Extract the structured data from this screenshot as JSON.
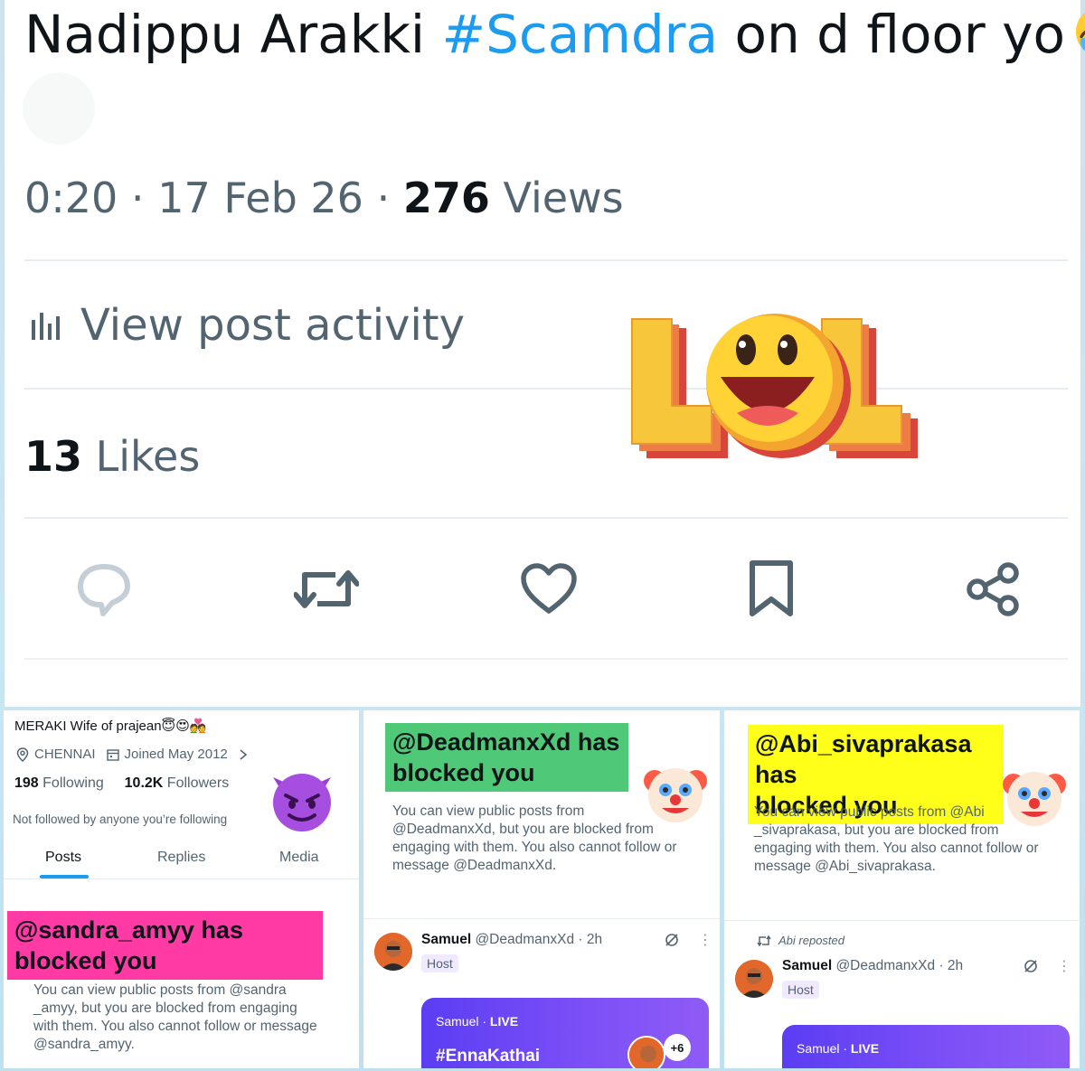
{
  "top_post": {
    "text_before": "Nadippu Arakki ",
    "hashtag": "#Scamdra",
    "text_after": " on d floor yo",
    "emoji": "rolling-on-floor-laughing-emoji",
    "meta_time": "0:20",
    "meta_sep": " · ",
    "meta_date": "17 Feb 26",
    "views_count": "276",
    "views_label": " Views",
    "activity_label": "View post activity",
    "likes_count": "13",
    "likes_label": " Likes",
    "sticker": "LOL",
    "actions": [
      "reply-icon",
      "repost-icon",
      "like-icon",
      "bookmark-icon",
      "share-icon"
    ],
    "colors": {
      "hashtag": "#1d9bf0",
      "muted": "#536471",
      "text": "#0f1419"
    }
  },
  "panel_sandra": {
    "bio": "MERAKI Wife of prajean😇😍💑",
    "location": "CHENNAI",
    "joined": "Joined May 2012",
    "following_count": "198",
    "following_label": " Following",
    "followers_count": "10.2K",
    "followers_label": " Followers",
    "not_followed": "Not followed by anyone you’re following",
    "tabs": [
      "Posts",
      "Replies",
      "Media"
    ],
    "block_title_line1": "@sandra_amyy has",
    "block_title_line2": "blocked you",
    "block_desc_lines": [
      "You can view public posts from @sandra",
      "_amyy, but you are blocked from engaging",
      "with them. You also cannot follow or message",
      "@sandra_amyy."
    ],
    "highlight_color": "#ff3aa5"
  },
  "panel_deadman": {
    "block_title_line1": "@DeadmanxXd has",
    "block_title_line2": "blocked you",
    "block_desc_lines": [
      "You can view public posts from",
      "@DeadmanxXd, but you are blocked from",
      "engaging with them. You also cannot follow or",
      "message @DeadmanxXd."
    ],
    "post_name": "Samuel",
    "post_handle": " @DeadmanxXd · 2h",
    "host_label": "Host",
    "live_name": "Samuel",
    "live_sep": " · ",
    "live_label": "LIVE",
    "live_title": "#EnnaKathai",
    "listeners_badge": "+6",
    "highlight_color": "#4fc978"
  },
  "panel_abi": {
    "block_title_line1": "@Abi_sivaprakasa has",
    "block_title_line2": "blocked you",
    "block_desc_lines": [
      "You can view public posts from @Abi",
      "_sivaprakasa, but you are blocked from",
      "engaging with them. You also cannot follow or",
      "message @Abi_sivaprakasa."
    ],
    "reposted_label": "Abi reposted",
    "post_name": "Samuel",
    "post_handle": " @DeadmanxXd · 2h",
    "host_label": "Host",
    "live_name": "Samuel",
    "live_sep": " · ",
    "live_label": "LIVE",
    "highlight_color": "#ffff1a"
  }
}
